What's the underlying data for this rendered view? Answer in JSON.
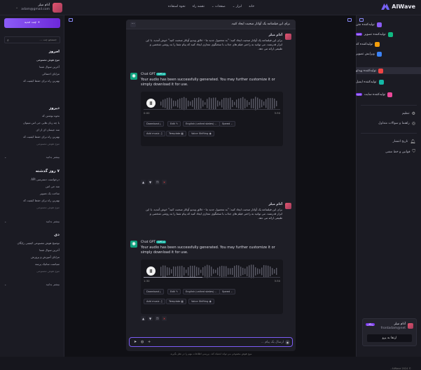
{
  "app": {
    "name": "AIWave"
  },
  "topnav": [
    "خانه",
    "ابزار",
    "صفحات",
    "نقشه راه",
    "نحوه استفاده"
  ],
  "user": {
    "name": "آدام میلر",
    "email": "adam@gmail.com"
  },
  "sidebar_right": {
    "tools": [
      {
        "label": "تولیدکننده متن",
        "color": "#8b5cf6"
      },
      {
        "label": "تولیدکننده تصویر",
        "color": "#10b981",
        "badge": "جدید"
      },
      {
        "label": "تولیدکننده کد",
        "color": "#f59e0b"
      },
      {
        "label": "ویرایش تصویر",
        "color": "#3b82f6"
      },
      {
        "label": "تولیدکننده ویدئو",
        "color": "#ef4444"
      },
      {
        "label": "تولیدکننده ایمیل",
        "color": "#14b8a6"
      },
      {
        "label": "تولیدکننده سایت",
        "color": "#ec4899",
        "badge": "جدید"
      }
    ],
    "settings": "تنظیم",
    "help": "راهنما و سوالات متداول",
    "changelog": "تاریخ انتشار",
    "terms": "قوانین و خط مشی",
    "card": {
      "name": "آدام میلر",
      "email": "frontadam@net",
      "badge": "رایگان",
      "upgrade": "ارتقا به پرو"
    },
    "copyright": "© AiWave 2024 ."
  },
  "sidebar_left": {
    "new_chat": "+ چت جدید",
    "search_placeholder": "جستجو چت ...",
    "groups": [
      {
        "title": "امروز",
        "items": [
          "موج هوش مصنوعی",
          "آخرین سوال شما",
          "مزایای احتمالی",
          "بهترین راه برای حفظ کیفیت کد"
        ]
      },
      {
        "title": "دیروز",
        "items": [
          "نحوه نوشتن کد",
          "با چه زبان هایی جی اس میتوان",
          "متد جیسان ای از ای",
          "بهترین راه برای حفظ کیفیت کد",
          "موج هوش مصنوعی"
        ]
      },
      {
        "title": "۷ روز گذشته",
        "items": [
          "درخواست دسترسی API",
          "متد جی اس",
          "ساخت یک تصویر",
          "بهترین راه برای حفظ کیفیت کد",
          "موج هوش مصنوعی"
        ]
      },
      {
        "title": "دی",
        "items": [
          "توضیح هوش مصنوعی کیفیتی رایگان",
          "آخرین سوال شما",
          "مزایای آموزش و پرورش",
          "سیاست سانیک پرسه",
          "موج هوش مصنوعی"
        ]
      }
    ],
    "view_more": "بیشتر بدانید"
  },
  "chat": {
    "title": "برای این فیلمنامه یک آواتار صحبت ایجاد کنید.",
    "messages": [
      {
        "user_name": "آدام میلر",
        "user_text": "برای این فیلمنامه یک آواتار صحبت ایجاد کنید: \"به محصول جدید ما - خالق ویدیو آواتار صحبت کنید\" خوش آمدید. با این ابزار قدرتمند، می توانید به راحتی فیلم های جذاب با سخنگوی مجازی ایجاد کنید که پیام شما را به روشی شخصی و طبیعی ارائه می دهد.",
        "bot_name": "Chat GPT",
        "bot_tag": "GPT-4",
        "bot_text": "Your audio has been successfully generated. You may further customize it or simply download it for use.",
        "time_start": "0:00",
        "time_end": "3:30",
        "progress": 0
      },
      {
        "user_name": "آدام میلر",
        "user_text": "برای این فیلمنامه یک آواتار صحبت ایجاد کنید: \"به محصول جدید ما - خالق ویدیو آواتار صحبت کنید\" خوش آمدید. با این ابزار قدرتمند، می توانید به راحتی فیلم های جذاب با سخنگوی مجازی ایجاد کنید که پیام شما را به روشی شخصی و طبیعی ارائه می دهد.",
        "bot_name": "Chat GPT",
        "bot_tag": "GPT-4",
        "bot_text": "Your audio has been successfully generated. You may further customize it or simply download it for use.",
        "time_start": "1:30",
        "time_end": "3:30",
        "progress": 0.43
      }
    ],
    "controls": {
      "download": "Download",
      "edit": "Edit",
      "language": "English (united states)",
      "speed": "Speed",
      "add_music": "Add music",
      "template": "Template",
      "voice": "Voice Shifting"
    },
    "composer_placeholder": "ارسال یک پیام ...",
    "footer": "موج هوش مصنوعی می تواند اشتباه کند. بررسی اطلاعات مهم را در نظر بگیرید."
  }
}
